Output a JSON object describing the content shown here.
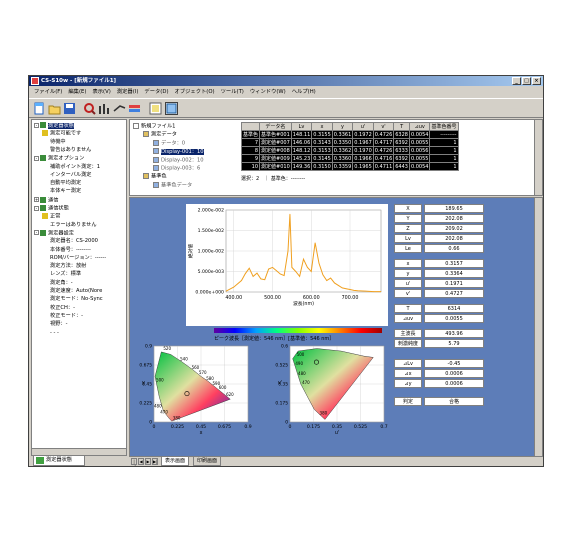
{
  "window": {
    "title": "CS-S10w - [新規ファイル1]"
  },
  "menu": [
    "ファイル(F)",
    "編集(E)",
    "表示(V)",
    "測定器(I)",
    "データ(D)",
    "オブジェクト(O)",
    "ツール(T)",
    "ウィンドウ(W)",
    "ヘルプ(H)"
  ],
  "toolbar": [
    "new-icon",
    "open-icon",
    "save-icon",
    "settings-icon",
    "measure-icon",
    "calibrate-icon",
    "target-icon",
    "window-icon",
    "layout-icon"
  ],
  "left_tree": [
    {
      "t": "測定器状態",
      "lvl": 0,
      "exp": "-",
      "hl": true
    },
    {
      "t": "測定可能です",
      "lvl": 1
    },
    {
      "t": "待機中",
      "lvl": 2
    },
    {
      "t": "警告はありません",
      "lvl": 2
    },
    {
      "t": "測定オプション",
      "lvl": 0,
      "exp": "-"
    },
    {
      "t": "補助ポイント測定：1",
      "lvl": 2
    },
    {
      "t": "インターバル測定",
      "lvl": 2
    },
    {
      "t": "自動平均測定",
      "lvl": 2
    },
    {
      "t": "本体キー測定",
      "lvl": 2
    },
    {
      "t": "通信",
      "lvl": 0,
      "exp": "+"
    },
    {
      "t": "通信状態",
      "lvl": 0,
      "exp": "-"
    },
    {
      "t": "正常",
      "lvl": 1
    },
    {
      "t": "エラーはありません",
      "lvl": 2
    },
    {
      "t": "測定器設定",
      "lvl": 0,
      "exp": "-"
    },
    {
      "t": "測定器名：CS-2000",
      "lvl": 2
    },
    {
      "t": "本体番号：--------",
      "lvl": 2
    },
    {
      "t": "ROM/バージョン：------",
      "lvl": 2
    },
    {
      "t": "測定方法：放射",
      "lvl": 2
    },
    {
      "t": "レンズ：標準",
      "lvl": 2
    },
    {
      "t": "測定角：-",
      "lvl": 2
    },
    {
      "t": "測定速度：Auto(Nore",
      "lvl": 2
    },
    {
      "t": "測定モード：No-Sync",
      "lvl": 2
    },
    {
      "t": "校正CH：-",
      "lvl": 2
    },
    {
      "t": "校正モード：-",
      "lvl": 2
    },
    {
      "t": "視野：-",
      "lvl": 2
    },
    {
      "t": "- - -",
      "lvl": 2
    }
  ],
  "left_tab": "測定器状態",
  "file_tree": [
    {
      "t": "新規ファイル1",
      "lvl": 0
    },
    {
      "t": "測定データ",
      "lvl": 1
    },
    {
      "t": "データ：0",
      "lvl": 2
    },
    {
      "t": "Display-001：10",
      "lvl": 2,
      "hl": true
    },
    {
      "t": "Display-002：10",
      "lvl": 2
    },
    {
      "t": "Display-003：6",
      "lvl": 2
    },
    {
      "t": "基準色",
      "lvl": 1
    },
    {
      "t": "基準色データ",
      "lvl": 2
    }
  ],
  "grid": {
    "headers": [
      "",
      "データ名",
      "Lv",
      "x",
      "y",
      "u'",
      "v'",
      "T",
      "⊿uv",
      "基準色番号"
    ],
    "rows": [
      {
        "rn": "基準色",
        "cells": [
          "基準色#001",
          "148.11",
          "0.3155",
          "0.3361",
          "0.1972",
          "0.4726",
          "6328",
          "0.0054",
          "---------"
        ],
        "dark": true
      },
      {
        "rn": "7",
        "cells": [
          "測定値#007",
          "146.06",
          "0.3143",
          "0.3350",
          "0.1967",
          "0.4717",
          "6392",
          "0.0055",
          "1"
        ],
        "dark": true
      },
      {
        "rn": "8",
        "cells": [
          "測定値#008",
          "148.12",
          "0.3153",
          "0.3362",
          "0.1970",
          "0.4726",
          "6333",
          "0.0056",
          "1"
        ],
        "dark": true
      },
      {
        "rn": "9",
        "cells": [
          "測定値#009",
          "145.23",
          "0.3145",
          "0.3360",
          "0.1966",
          "0.4716",
          "6392",
          "0.0055",
          "1"
        ],
        "dark": true
      },
      {
        "rn": "10",
        "cells": [
          "測定値#010",
          "149.36",
          "0.3150",
          "0.3359",
          "0.1965",
          "0.4711",
          "6443",
          "0.0054",
          "1"
        ],
        "dark": true
      }
    ],
    "footer": "選択：2　｜ 基準色：--------"
  },
  "values": [
    {
      "l": "X",
      "v": "189.65"
    },
    {
      "l": "Y",
      "v": "202.08"
    },
    {
      "l": "Z",
      "v": "209.02"
    },
    {
      "l": "Lv",
      "v": "202.08"
    },
    {
      "l": "Le",
      "v": "0.66"
    },
    {
      "l": "x",
      "v": "0.3157"
    },
    {
      "l": "y",
      "v": "0.3364"
    },
    {
      "l": "u'",
      "v": "0.1971"
    },
    {
      "l": "v'",
      "v": "0.4727"
    },
    {
      "l": "T",
      "v": "6314"
    },
    {
      "l": "⊿uv",
      "v": "0.0055"
    },
    {
      "l": "主波長",
      "v": "493.96"
    },
    {
      "l": "刺激純度",
      "v": "5.79"
    },
    {
      "l": "⊿Lv",
      "v": "-0.45"
    },
    {
      "l": "⊿x",
      "v": "0.0006"
    },
    {
      "l": "⊿y",
      "v": "0.0006"
    },
    {
      "l": "判定",
      "v": "合格"
    }
  ],
  "bottom_tabs": [
    "表示画面",
    "印刷画面"
  ],
  "colorbar_label": "ピーク波長［測定値：546 nm］[基準値：546 nm］",
  "chart_data": [
    {
      "type": "line",
      "title": "",
      "xlabel": "波長(nm)",
      "ylabel": "絶対値",
      "xlim": [
        380,
        780
      ],
      "ylim": [
        0,
        0.02
      ],
      "xticks": [
        "400.00",
        "500.00",
        "600.00",
        "700.00"
      ],
      "yticks": [
        "0.000e+000",
        "5.000e-003",
        "1.000e-002",
        "1.500e-002",
        "2.000e-002"
      ],
      "x": [
        380,
        400,
        420,
        430,
        440,
        450,
        460,
        470,
        480,
        490,
        500,
        510,
        520,
        530,
        540,
        545,
        550,
        560,
        570,
        580,
        585,
        590,
        600,
        610,
        612,
        620,
        630,
        640,
        650,
        660,
        670,
        680,
        690,
        700,
        710,
        720,
        740,
        760,
        780
      ],
      "values": [
        0.0002,
        0.0012,
        0.0028,
        0.0045,
        0.0058,
        0.0038,
        0.0046,
        0.0032,
        0.003,
        0.0056,
        0.006,
        0.0052,
        0.0044,
        0.004,
        0.01,
        0.019,
        0.006,
        0.005,
        0.0038,
        0.008,
        0.007,
        0.006,
        0.005,
        0.012,
        0.011,
        0.007,
        0.0042,
        0.0028,
        0.0034,
        0.0022,
        0.0016,
        0.001,
        0.0008,
        0.0006,
        0.0004,
        0.0003,
        0.0002,
        0.0001,
        0.0001
      ],
      "color": "#f0a020"
    },
    {
      "type": "scatter",
      "title": "",
      "xlabel": "x",
      "ylabel": "y",
      "xlim": [
        0,
        0.9
      ],
      "ylim": [
        0,
        0.9
      ],
      "xticks": [
        "0",
        "0.225",
        "0.45",
        "0.675",
        "0.9"
      ],
      "yticks": [
        "0",
        "0.225",
        "0.45",
        "0.675",
        "0.9"
      ],
      "wavelength_labels": [
        "520",
        "540",
        "560",
        "570",
        "580",
        "590",
        "600",
        "620",
        "470",
        "480",
        "500",
        "380"
      ],
      "points": [
        {
          "x": 0.3157,
          "y": 0.3364
        }
      ]
    },
    {
      "type": "scatter",
      "title": "",
      "xlabel": "u'",
      "ylabel": "v'",
      "xlim": [
        0,
        0.7
      ],
      "ylim": [
        0,
        0.6
      ],
      "xticks": [
        "0",
        "0.175",
        "0.35",
        "0.525",
        "0.7"
      ],
      "yticks": [
        "0",
        "0.175",
        "0.35",
        "0.525",
        "0.6"
      ],
      "wavelength_labels": [
        "500",
        "490",
        "480",
        "470",
        "380"
      ],
      "points": [
        {
          "x": 0.1971,
          "y": 0.4727
        }
      ]
    }
  ]
}
